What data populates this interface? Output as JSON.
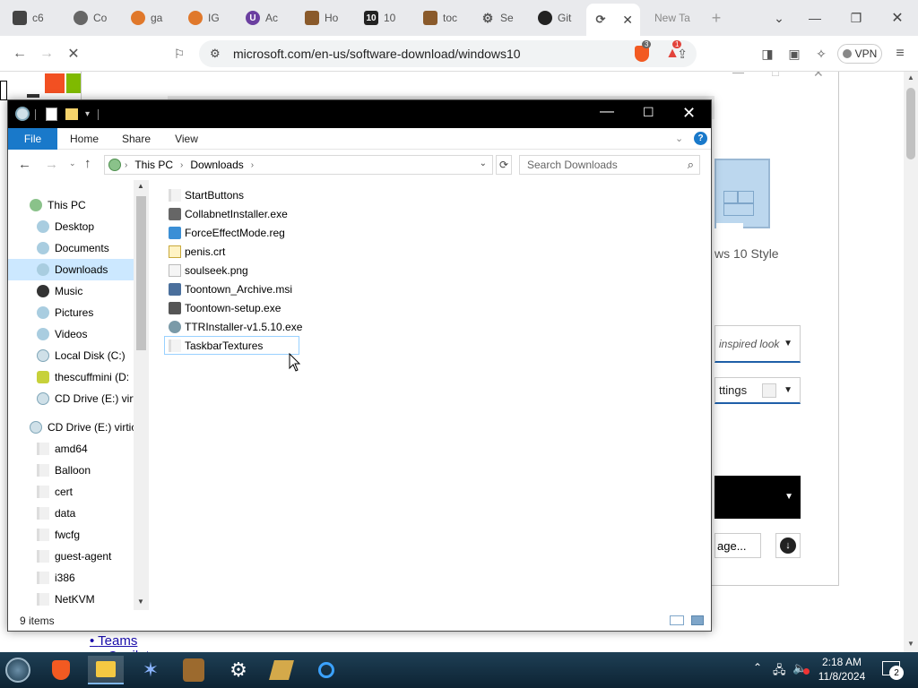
{
  "browser": {
    "tabs": [
      {
        "label": "c6"
      },
      {
        "label": "Co"
      },
      {
        "label": "ga"
      },
      {
        "label": "IG"
      },
      {
        "label": "Ac"
      },
      {
        "label": "Ho"
      },
      {
        "label": "10"
      },
      {
        "label": "toc"
      },
      {
        "label": "Se"
      },
      {
        "label": "Git"
      },
      {
        "label": ""
      },
      {
        "label": "New Ta"
      }
    ],
    "url": "microsoft.com/en-us/software-download/windows10",
    "vpn_label": "VPN",
    "badge_count": "3",
    "alert_count": "1"
  },
  "webpage": {
    "style_label": "ws 10 Style",
    "dropdown1": "inspired look",
    "dropdown2": "ttings",
    "page_button": "age...",
    "teams_link": "Teams",
    "copilot_link": "Copilot"
  },
  "explorer": {
    "ribbon_tabs": {
      "file": "File",
      "home": "Home",
      "share": "Share",
      "view": "View"
    },
    "help": "?",
    "path": {
      "root": "This PC",
      "current": "Downloads"
    },
    "search_placeholder": "Search Downloads",
    "tree": [
      {
        "label": "This PC",
        "level": 0
      },
      {
        "label": "Desktop",
        "level": 1
      },
      {
        "label": "Documents",
        "level": 1
      },
      {
        "label": "Downloads",
        "level": 1,
        "selected": true
      },
      {
        "label": "Music",
        "level": 1
      },
      {
        "label": "Pictures",
        "level": 1
      },
      {
        "label": "Videos",
        "level": 1
      },
      {
        "label": "Local Disk (C:)",
        "level": 1
      },
      {
        "label": "thescuffmini (D:",
        "level": 1
      },
      {
        "label": "CD Drive (E:) virt",
        "level": 1
      },
      {
        "label": "CD Drive (E:) virtic",
        "level": 0
      },
      {
        "label": "amd64",
        "level": 1
      },
      {
        "label": "Balloon",
        "level": 1
      },
      {
        "label": "cert",
        "level": 1
      },
      {
        "label": "data",
        "level": 1
      },
      {
        "label": "fwcfg",
        "level": 1
      },
      {
        "label": "guest-agent",
        "level": 1
      },
      {
        "label": "i386",
        "level": 1
      },
      {
        "label": "NetKVM",
        "level": 1
      }
    ],
    "files": [
      {
        "name": "StartButtons",
        "icon": "folder-icon"
      },
      {
        "name": "CollabnetInstaller.exe",
        "icon": "exe-icon"
      },
      {
        "name": "ForceEffectMode.reg",
        "icon": "registry-icon"
      },
      {
        "name": "penis.crt",
        "icon": "certificate-icon"
      },
      {
        "name": "soulseek.png",
        "icon": "image-icon"
      },
      {
        "name": "Toontown_Archive.msi",
        "icon": "installer-icon"
      },
      {
        "name": "Toontown-setup.exe",
        "icon": "exe-icon"
      },
      {
        "name": "TTRInstaller-v1.5.10.exe",
        "icon": "exe-icon"
      },
      {
        "name": "TaskbarTextures",
        "icon": "folder-icon"
      }
    ],
    "status": "9 items"
  },
  "taskbar": {
    "time": "2:18 AM",
    "date": "11/8/2024",
    "notification_count": "2"
  }
}
